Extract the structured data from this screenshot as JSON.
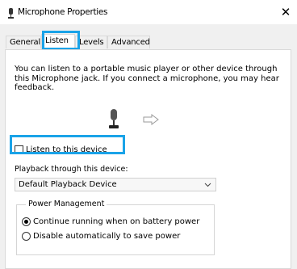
{
  "window": {
    "title": "Microphone Properties",
    "close_symbol": "✕"
  },
  "tabs": [
    {
      "label": "General"
    },
    {
      "label": "Listen",
      "selected": true
    },
    {
      "label": "Levels"
    },
    {
      "label": "Advanced"
    }
  ],
  "listen": {
    "description": "You can listen to a portable music player or other device through this Microphone jack.  If you connect a microphone, you may hear feedback.",
    "device_icon": "microphone-icon",
    "output_icon": "arrow-right-icon",
    "listen_checkbox_label": "Listen to this device",
    "listen_checked": false,
    "playback_label": "Playback through this device:",
    "playback_value": "Default Playback Device",
    "power_group_title": "Power Management",
    "power_options": [
      {
        "label": "Continue running when on battery power",
        "selected": true
      },
      {
        "label": "Disable automatically to save power",
        "selected": false
      }
    ]
  },
  "colors": {
    "highlight": "#1aa3e8",
    "dialog_bg": "#f0f0f0"
  }
}
